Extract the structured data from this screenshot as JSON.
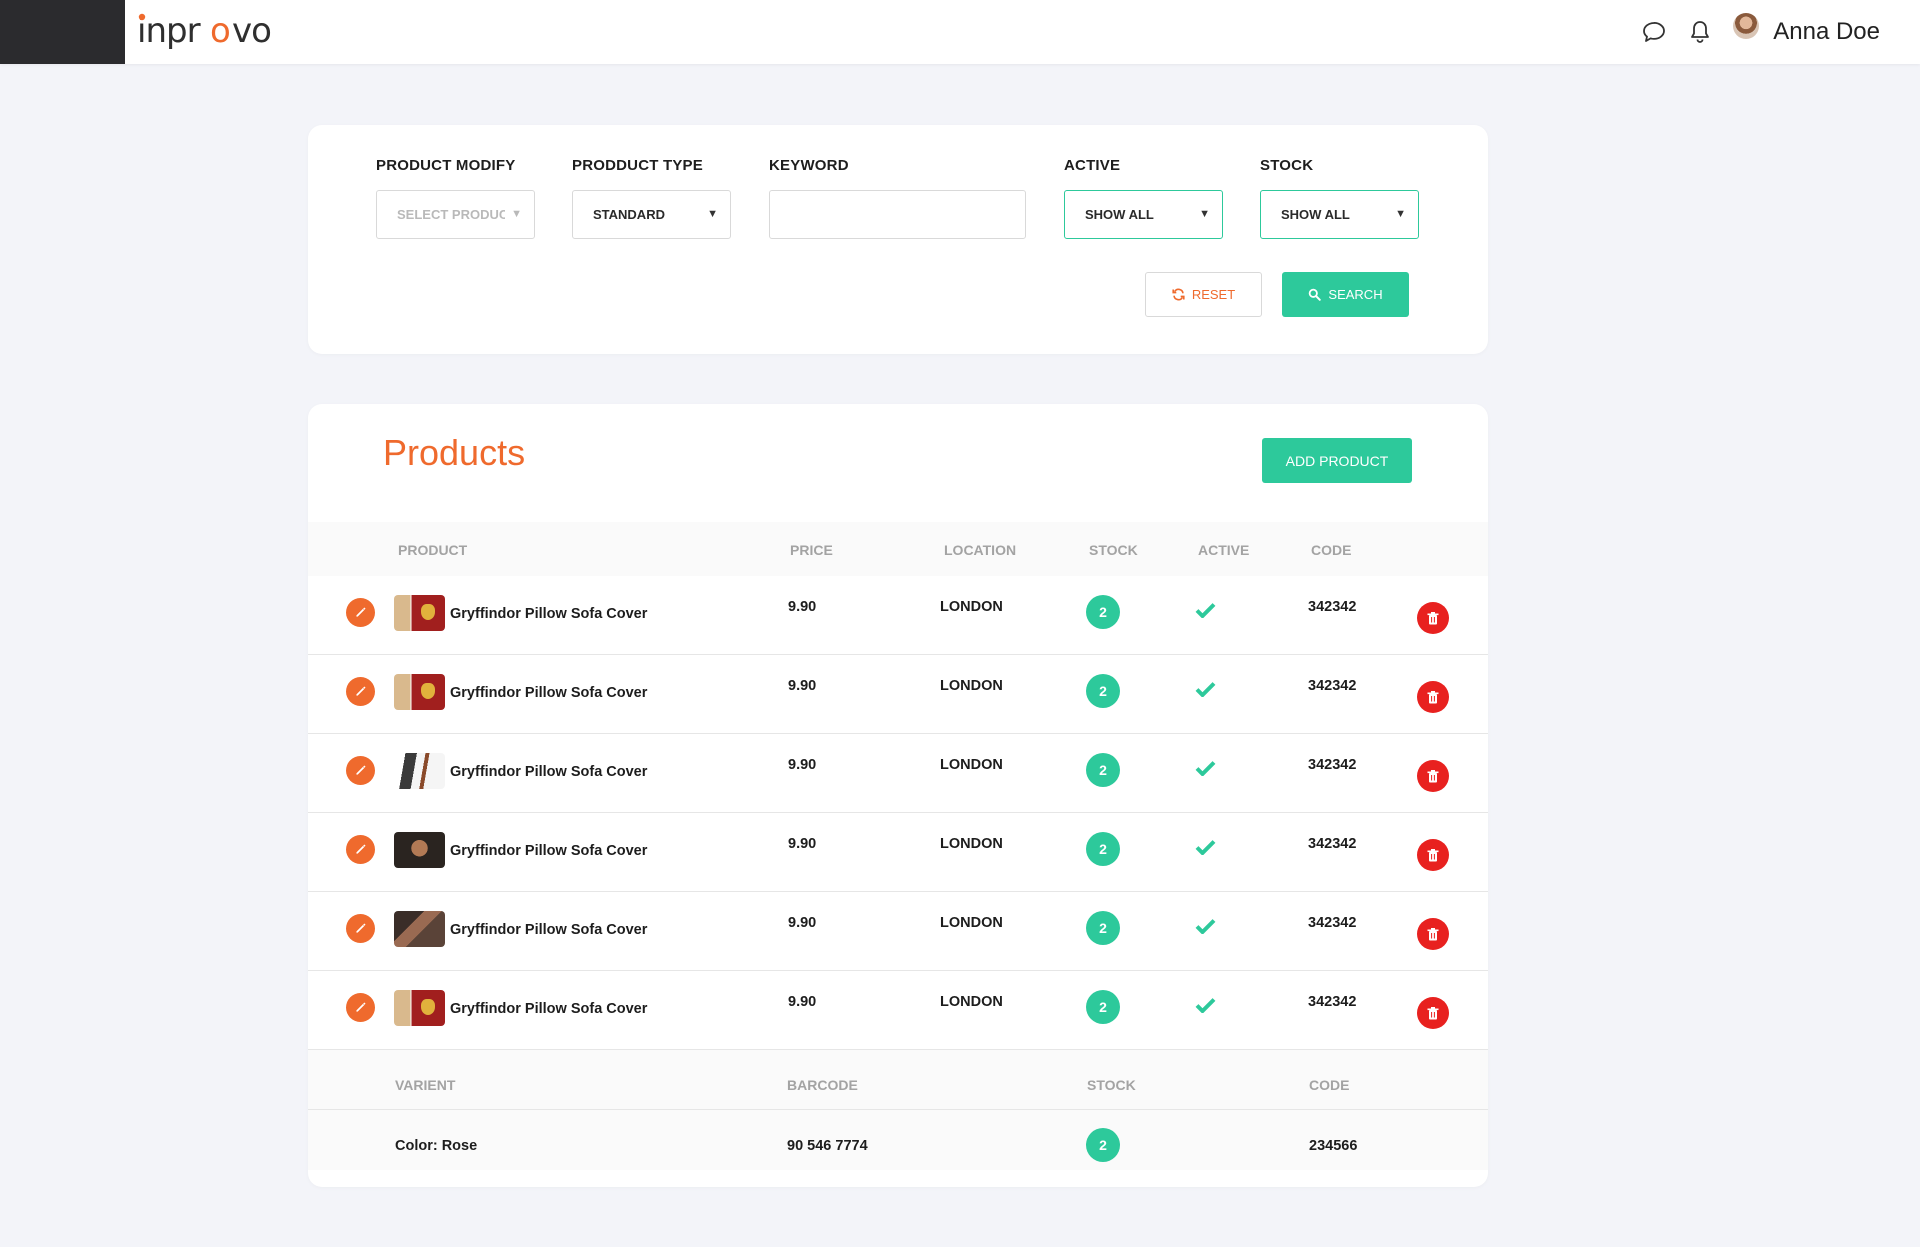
{
  "header": {
    "logo_text": "inprovo",
    "user_name": "Anna Doe",
    "icons": [
      "chat-icon",
      "bell-icon"
    ]
  },
  "filters": {
    "product_modify": {
      "label": "PRODUCT MODIFY",
      "value": "SELECT PRODUCT"
    },
    "product_type": {
      "label": "PRODDUCT TYPE",
      "value": "STANDARD"
    },
    "keyword": {
      "label": "KEYWORD",
      "value": ""
    },
    "active": {
      "label": "ACTIVE",
      "value": "SHOW ALL"
    },
    "stock": {
      "label": "STOCK",
      "value": "SHOW ALL"
    },
    "reset_label": "RESET",
    "search_label": "SEARCH"
  },
  "products": {
    "title": "Products",
    "add_label": "ADD PRODUCT",
    "columns": {
      "product": "PRODUCT",
      "price": "PRICE",
      "location": "LOCATION",
      "stock": "STOCK",
      "active": "ACTIVE",
      "code": "CODE"
    },
    "rows": [
      {
        "name": "Gryffindor Pillow Sofa Cover",
        "thumb": "pillow",
        "price": "9.90",
        "location": "LONDON",
        "stock": "2",
        "active": true,
        "code": "342342"
      },
      {
        "name": "Gryffindor Pillow Sofa Cover",
        "thumb": "pillow",
        "price": "9.90",
        "location": "LONDON",
        "stock": "2",
        "active": true,
        "code": "342342"
      },
      {
        "name": "Gryffindor Pillow Sofa Cover",
        "thumb": "phone",
        "price": "9.90",
        "location": "LONDON",
        "stock": "2",
        "active": true,
        "code": "342342"
      },
      {
        "name": "Gryffindor Pillow Sofa Cover",
        "thumb": "face",
        "price": "9.90",
        "location": "LONDON",
        "stock": "2",
        "active": true,
        "code": "342342"
      },
      {
        "name": "Gryffindor Pillow Sofa Cover",
        "thumb": "moto",
        "price": "9.90",
        "location": "LONDON",
        "stock": "2",
        "active": true,
        "code": "342342"
      },
      {
        "name": "Gryffindor Pillow Sofa Cover",
        "thumb": "pillow",
        "price": "9.90",
        "location": "LONDON",
        "stock": "2",
        "active": true,
        "code": "342342"
      }
    ],
    "variant_columns": {
      "variant": "VARIENT",
      "barcode": "BARCODE",
      "stock": "STOCK",
      "code": "CODE"
    },
    "variant_row": {
      "variant": "Color: Rose",
      "barcode": "90 546 7774",
      "stock": "2",
      "code": "234566"
    }
  },
  "colors": {
    "accent_orange": "#ef6a2d",
    "accent_green": "#2dc99b",
    "delete_red": "#e8211f"
  }
}
